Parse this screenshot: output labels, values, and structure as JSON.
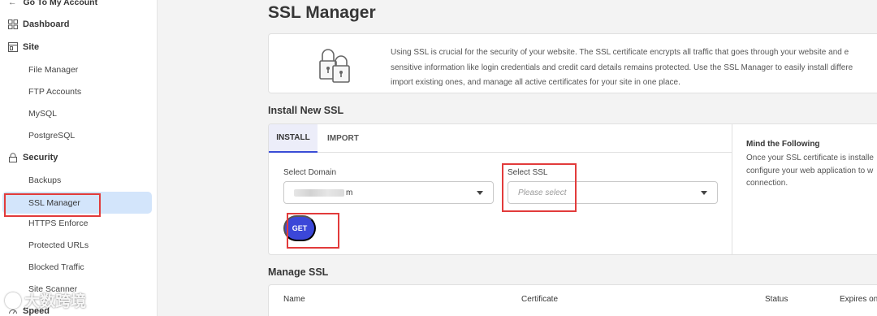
{
  "sidebar": {
    "back_label": "Go To My Account",
    "dashboard_label": "Dashboard",
    "site_label": "Site",
    "site_items": [
      "File Manager",
      "FTP Accounts",
      "MySQL",
      "PostgreSQL"
    ],
    "security_label": "Security",
    "security_items": [
      "Backups",
      "SSL Manager",
      "HTTPS Enforce",
      "Protected URLs",
      "Blocked Traffic",
      "Site Scanner"
    ],
    "speed_label": "Speed",
    "active_item": "SSL Manager"
  },
  "page": {
    "title": "SSL Manager",
    "info_lines": [
      "Using SSL is crucial for the security of your website. The SSL certificate encrypts all traffic that goes through your website and e",
      "sensitive information like login credentials and credit card details remains protected. Use the SSL Manager to easily install differe",
      "import existing ones, and manage all active certificates for your site in one place."
    ]
  },
  "install": {
    "section_title": "Install New SSL",
    "tabs": [
      "INSTALL",
      "IMPORT"
    ],
    "domain_label": "Select Domain",
    "domain_value_suffix": "m",
    "ssl_label": "Select SSL",
    "ssl_placeholder": "Please select",
    "get_button": "GET",
    "side_title": "Mind the Following",
    "side_lines": [
      "Once your SSL certificate is installe",
      "configure your web application to w",
      "connection."
    ]
  },
  "manage": {
    "section_title": "Manage SSL",
    "columns": [
      "Name",
      "Certificate",
      "Status",
      "Expires on"
    ]
  },
  "watermark": "大数跨境",
  "colors": {
    "accent": "#3b47d8",
    "active_bg": "#d3e5fb",
    "highlight_box": "#e23b3b"
  }
}
